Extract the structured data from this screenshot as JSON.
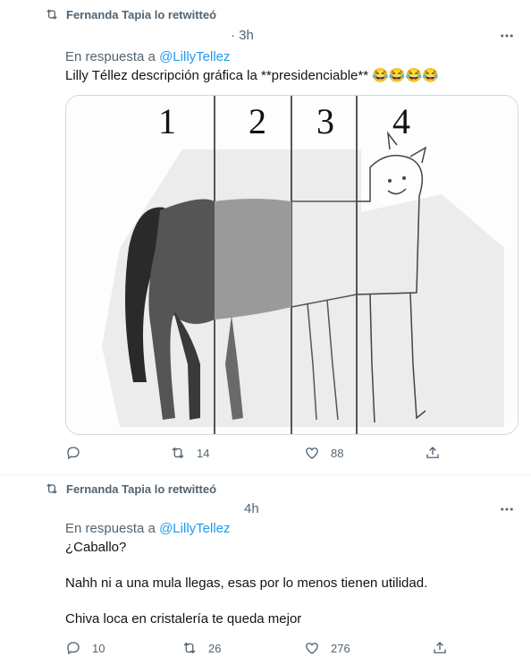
{
  "tweets": [
    {
      "retweeted_by": "Fernanda Tapia lo retwitteó",
      "time": "· 3h",
      "reply_prefix": "En respuesta a ",
      "reply_mention": "@LillyTellez",
      "lines": [
        "Lilly Téllez descripción gráfica la **presidenciable** 😂😂😂😂"
      ],
      "media": {
        "panel_numbers": [
          "1",
          "2",
          "3",
          "4"
        ],
        "description_icon": "horse-drawing-image"
      },
      "actions": {
        "reply": "",
        "retweet": "14",
        "like": "88"
      }
    },
    {
      "retweeted_by": "Fernanda Tapia lo retwitteó",
      "time": "4h",
      "reply_prefix": "En respuesta a ",
      "reply_mention": "@LillyTellez",
      "lines": [
        "¿Caballo?",
        "Nahh ni a una mula llegas, esas por lo menos tienen utilidad.",
        "Chiva loca en cristalería te queda mejor"
      ],
      "actions": {
        "reply": "10",
        "retweet": "26",
        "like": "276"
      }
    }
  ],
  "colors": {
    "accent": "#1d9bf0",
    "muted": "#536471",
    "text": "#0f1419",
    "border": "#cfd9de"
  }
}
